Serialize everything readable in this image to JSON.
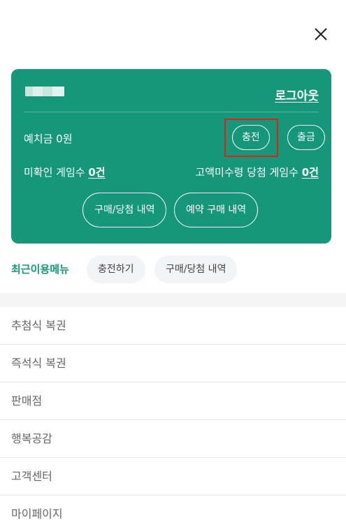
{
  "close": {
    "icon": "close-icon"
  },
  "account": {
    "logout_label": "로그아웃",
    "deposit_label": "예치금 0원",
    "charge_label": "충전",
    "withdraw_label": "출금",
    "unconfirmed_label": "미확인 게임수",
    "unconfirmed_count": "0건",
    "highprize_label": "고액미수령 당첨 게임수",
    "highprize_count": "0건",
    "history_button": "구매/당첨 내역",
    "reserve_button": "예약 구매 내역",
    "card_color": "#16977a"
  },
  "recent": {
    "label": "최근이용메뉴",
    "chips": [
      "충전하기",
      "구매/당첨 내역"
    ]
  },
  "menu": {
    "items": [
      "추첨식 복권",
      "즉석식 복권",
      "판매점",
      "행복공감",
      "고객센터",
      "마이페이지"
    ]
  }
}
